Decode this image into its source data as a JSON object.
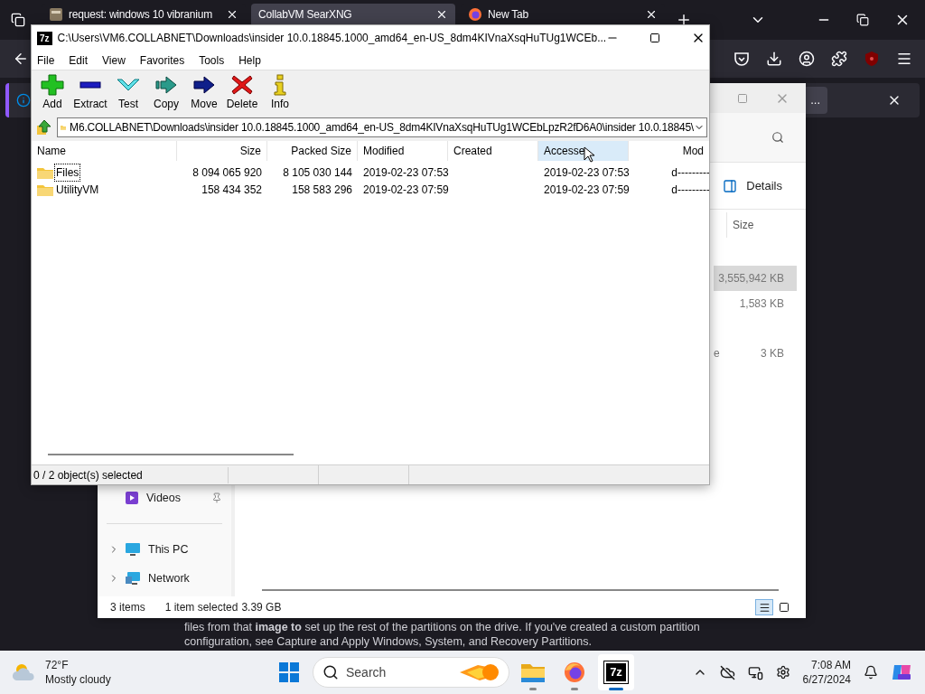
{
  "browser": {
    "tabs": [
      {
        "title": "request: windows 10 vibranium",
        "selected": false,
        "kind": "page"
      },
      {
        "title": "CollabVM SearXNG",
        "selected": true,
        "kind": "plain"
      },
      {
        "title": "New Tab",
        "selected": false,
        "kind": "firefox"
      }
    ],
    "notification_button": "...",
    "content_lines": [
      "files from that **image to** set up the rest of the partitions on the drive. If you've created a custom partition",
      "configuration, see Capture and Apply Windows, System, and Recovery Partitions."
    ]
  },
  "explorer": {
    "details_button": "Details",
    "columns": [
      "Size"
    ],
    "rows": [
      {
        "size": "3,555,942 KB",
        "selected": true
      },
      {
        "size": "1,583 KB",
        "selected": false
      },
      {
        "name": "e",
        "size": "3 KB",
        "selected": false
      }
    ],
    "nav_items": [
      {
        "kind": "videos",
        "label": "Videos",
        "pinned": true,
        "expandable": false
      },
      {
        "kind": "pc",
        "label": "This PC",
        "pinned": false,
        "expandable": true
      },
      {
        "kind": "network",
        "label": "Network",
        "pinned": false,
        "expandable": true
      }
    ],
    "status": {
      "count": "3 items",
      "selection": "1 item selected",
      "size": "3.39 GB"
    },
    "view_modes": [
      {
        "kind": "details",
        "selected": true
      },
      {
        "kind": "tiles",
        "selected": false
      }
    ]
  },
  "sevenzip": {
    "app_logo": "7z",
    "title": "C:\\Users\\VM6.COLLABNET\\Downloads\\insider 10.0.18845.1000_amd64_en-US_8dm4KIVnaXsqHuTUg1WCEb...",
    "menu": [
      "File",
      "Edit",
      "View",
      "Favorites",
      "Tools",
      "Help"
    ],
    "tools": [
      {
        "kind": "add",
        "label": "Add"
      },
      {
        "kind": "extract",
        "label": "Extract"
      },
      {
        "kind": "test",
        "label": "Test"
      },
      {
        "kind": "copy",
        "label": "Copy"
      },
      {
        "kind": "move",
        "label": "Move"
      },
      {
        "kind": "delete",
        "label": "Delete"
      },
      {
        "kind": "info",
        "label": "Info"
      }
    ],
    "address": "M6.COLLABNET\\Downloads\\insider 10.0.18845.1000_amd64_en-US_8dm4KIVnaXsqHuTUg1WCEbLpzR2fD6A0\\insider 10.0.18845\\",
    "columns": [
      {
        "label": "Name",
        "hovered": false
      },
      {
        "label": "Size",
        "hovered": false
      },
      {
        "label": "Packed Size",
        "hovered": false
      },
      {
        "label": "Modified",
        "hovered": false
      },
      {
        "label": "Created",
        "hovered": false
      },
      {
        "label": "Accesse",
        "hovered": true
      },
      {
        "label": "Mod",
        "hovered": false
      }
    ],
    "rows": [
      {
        "cells": [
          "Files",
          "8 094 065 920",
          "8 105 030 144",
          "2019-02-23 07:53",
          "",
          "2019-02-23 07:53",
          "d---------"
        ],
        "focused": true
      },
      {
        "cells": [
          "UtilityVM",
          "158 434 352",
          "158 583 296",
          "2019-02-23 07:59",
          "",
          "2019-02-23 07:59",
          "d---------"
        ],
        "focused": false
      }
    ],
    "status": "0 / 2 object(s) selected"
  },
  "taskbar": {
    "weather": {
      "temperature": "72°F",
      "condition": "Mostly cloudy"
    },
    "search": {
      "placeholder": "Search"
    },
    "apps": [
      {
        "kind": "explorer",
        "active": false
      },
      {
        "kind": "firefox",
        "active": false
      },
      {
        "kind": "sevenzip",
        "label": "7z",
        "active": true
      }
    ],
    "clock": {
      "time": "7:08 AM",
      "date": "6/27/2024"
    }
  }
}
